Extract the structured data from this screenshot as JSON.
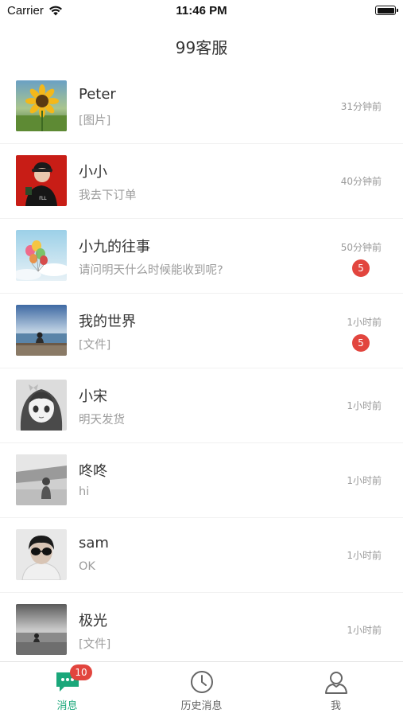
{
  "status_bar": {
    "carrier": "Carrier",
    "time": "11:46 PM"
  },
  "nav": {
    "title": "99客服"
  },
  "conversations": [
    {
      "name": "Peter",
      "message": "[图片]",
      "time": "31分钟前",
      "badge": ""
    },
    {
      "name": "小小",
      "message": "我去下订单",
      "time": "40分钟前",
      "badge": ""
    },
    {
      "name": "小九的往事",
      "message": "请问明天什么时候能收到呢?",
      "time": "50分钟前",
      "badge": "5"
    },
    {
      "name": "我的世界",
      "message": "[文件]",
      "time": "1小时前",
      "badge": "5"
    },
    {
      "name": "小宋",
      "message": "明天发货",
      "time": "1小时前",
      "badge": ""
    },
    {
      "name": "咚咚",
      "message": "hi",
      "time": "1小时前",
      "badge": ""
    },
    {
      "name": "sam",
      "message": "OK",
      "time": "1小时前",
      "badge": ""
    },
    {
      "name": "极光",
      "message": "[文件]",
      "time": "1小时前",
      "badge": ""
    }
  ],
  "tabbar": {
    "tabs": [
      {
        "label": "消息",
        "icon": "chat-icon",
        "badge": "10",
        "active": true
      },
      {
        "label": "历史消息",
        "icon": "clock-icon",
        "badge": "",
        "active": false
      },
      {
        "label": "我",
        "icon": "person-icon",
        "badge": "",
        "active": false
      }
    ]
  },
  "colors": {
    "accent": "#1aa77a",
    "badge": "#e2453e"
  }
}
